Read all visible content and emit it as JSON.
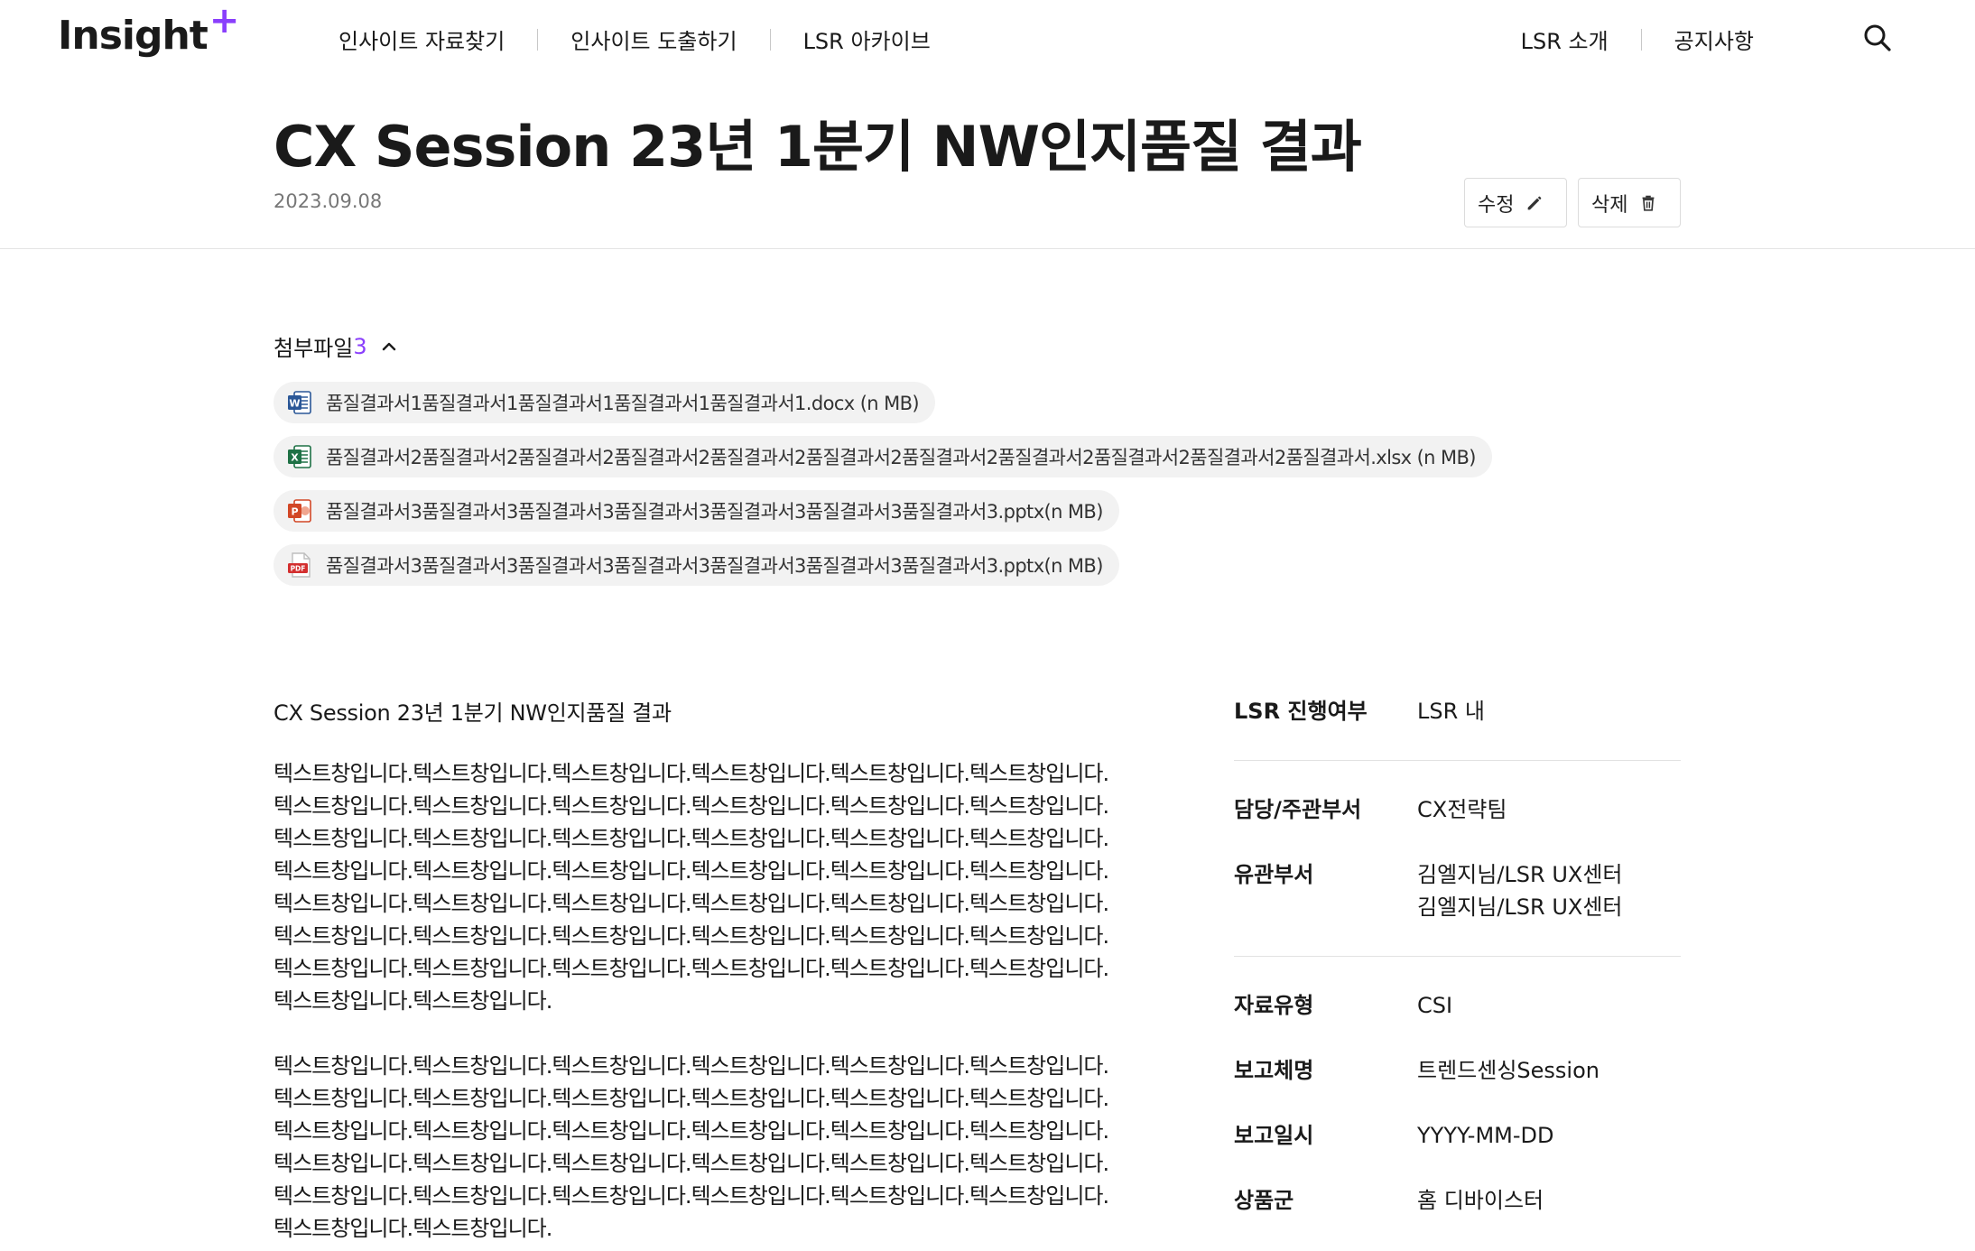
{
  "header": {
    "logo": "Insight",
    "logo_plus": "+",
    "nav": [
      "인사이트 자료찾기",
      "인사이트 도출하기",
      "LSR 아카이브"
    ],
    "util": [
      "LSR 소개",
      "공지사항"
    ]
  },
  "post": {
    "title": "CX Session 23년 1분기 NW인지품질 결과",
    "date": "2023.09.08",
    "edit_label": "수정",
    "delete_label": "삭제"
  },
  "attachments": {
    "label": "첨부파일",
    "count": "3",
    "files": [
      {
        "type": "word",
        "name": "품질결과서1품질결과서1품질결과서1품질결과서1품질결과서1.docx (n MB)"
      },
      {
        "type": "excel",
        "name": "품질결과서2품질결과서2품질결과서2품질결과서2품질결과서2품질결과서2품질결과서2품질결과서2품질결과서2품질결과서2품질결과서.xlsx (n MB)"
      },
      {
        "type": "ppt",
        "name": "품질결과서3품질결과서3품질결과서3품질결과서3품질결과서3품질결과서3품질결과서3.pptx(n MB)"
      },
      {
        "type": "pdf",
        "name": "품질결과서3품질결과서3품질결과서3품질결과서3품질결과서3품질결과서3품질결과서3.pptx(n MB)"
      }
    ]
  },
  "content": {
    "subtitle": "CX Session 23년 1분기 NW인지품질 결과",
    "paragraph1": "텍스트창입니다.텍스트창입니다.텍스트창입니다.텍스트창입니다.텍스트창입니다.텍스트창입니다.텍스트창입니다.텍스트창입니다.텍스트창입니다.텍스트창입니다.텍스트창입니다.텍스트창입니다.텍스트창입니다.텍스트창입니다.텍스트창입니다.텍스트창입니다.텍스트창입니다.텍스트창입니다.텍스트창입니다.텍스트창입니다.텍스트창입니다.텍스트창입니다.텍스트창입니다.텍스트창입니다.텍스트창입니다.텍스트창입니다.텍스트창입니다.텍스트창입니다.텍스트창입니다.텍스트창입니다.텍스트창입니다.텍스트창입니다.텍스트창입니다.텍스트창입니다.텍스트창입니다.텍스트창입니다.텍스트창입니다.텍스트창입니다.텍스트창입니다.텍스트창입니다.텍스트창입니다.텍스트창입니다.텍스트창입니다.텍스트창입니다.",
    "paragraph2": "텍스트창입니다.텍스트창입니다.텍스트창입니다.텍스트창입니다.텍스트창입니다.텍스트창입니다.텍스트창입니다.텍스트창입니다.텍스트창입니다.텍스트창입니다.텍스트창입니다.텍스트창입니다.텍스트창입니다.텍스트창입니다.텍스트창입니다.텍스트창입니다.텍스트창입니다.텍스트창입니다.텍스트창입니다.텍스트창입니다.텍스트창입니다.텍스트창입니다.텍스트창입니다.텍스트창입니다.텍스트창입니다.텍스트창입니다.텍스트창입니다.텍스트창입니다.텍스트창입니다.텍스트창입니다.텍스트창입니다.텍스트창입니다."
  },
  "info": {
    "lsr_progress": {
      "label": "LSR 진행여부",
      "value": "LSR 내"
    },
    "dept": {
      "label": "담당/주관부서",
      "value": "CX전략팀"
    },
    "related": {
      "label": "유관부서",
      "value1": "김엘지님/LSR UX센터",
      "value2": "김엘지님/LSR UX센터"
    },
    "data_type": {
      "label": "자료유형",
      "value": "CSI"
    },
    "report_system": {
      "label": "보고체명",
      "value": "트렌드센싱Session"
    },
    "report_date": {
      "label": "보고일시",
      "value": "YYYY-MM-DD"
    },
    "product": {
      "label": "상품군",
      "value": "홈 디바이스터"
    }
  },
  "colors": {
    "accent": "#8a3ffc",
    "word": "#2b5797",
    "excel": "#1e7145",
    "ppt": "#d24726",
    "pdf": "#d32f2f"
  }
}
